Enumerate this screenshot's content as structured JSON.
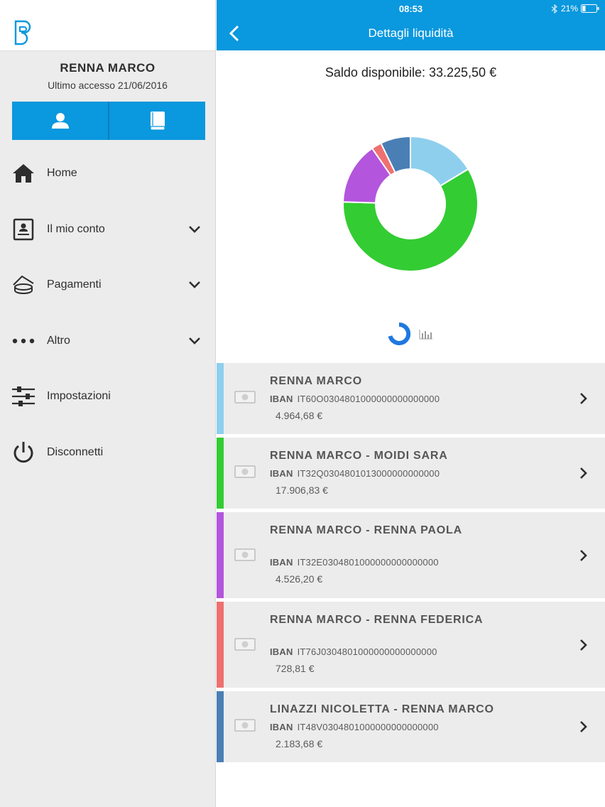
{
  "user": {
    "name": "RENNA MARCO",
    "last_access": "Ultimo accesso 21/06/2016"
  },
  "menu": [
    {
      "label": "Home",
      "icon": "home-icon",
      "expandable": false
    },
    {
      "label": "Il mio conto",
      "icon": "account-card-icon",
      "expandable": true
    },
    {
      "label": "Pagamenti",
      "icon": "payments-icon",
      "expandable": true
    },
    {
      "label": "Altro",
      "icon": "more-dots-icon",
      "expandable": true
    },
    {
      "label": "Impostazioni",
      "icon": "settings-sliders-icon",
      "expandable": false
    },
    {
      "label": "Disconnetti",
      "icon": "power-icon",
      "expandable": false
    }
  ],
  "status": {
    "time": "08:53",
    "battery": "21%"
  },
  "header": {
    "title": "Dettagli liquidità"
  },
  "saldo": "Saldo disponibile: 33.225,50 €",
  "accounts": [
    {
      "name": "RENNA MARCO",
      "iban_label": "IBAN",
      "iban": "IT60O0304801000000000000000",
      "amount": "4.964,68 €",
      "color": "#8ecfee"
    },
    {
      "name": "RENNA MARCO - MOIDI  SARA",
      "iban_label": "IBAN",
      "iban": "IT32Q0304801013000000000000",
      "amount": "17.906,83 €",
      "color": "#33cc33"
    },
    {
      "name": "RENNA MARCO - RENNA  PAOLA",
      "iban_label": "IBAN",
      "iban": "IT32E0304801000000000000000",
      "amount": "4.526,20 €",
      "color": "#b355dd"
    },
    {
      "name": "RENNA MARCO - RENNA  FEDERICA",
      "iban_label": "IBAN",
      "iban": "IT76J0304801000000000000000",
      "amount": "728,81 €",
      "color": "#ef7070"
    },
    {
      "name": "LINAZZI NICOLETTA  -  RENNA MARCO",
      "iban_label": "IBAN",
      "iban": "IT48V0304801000000000000000",
      "amount": "2.183,68 €",
      "color": "#4a7fb5"
    }
  ],
  "chart_data": {
    "type": "pie",
    "donut": true,
    "categories": [
      "RENNA MARCO",
      "RENNA MARCO - MOIDI  SARA",
      "RENNA MARCO - RENNA  PAOLA",
      "RENNA MARCO - RENNA  FEDERICA",
      "LINAZZI NICOLETTA  -  RENNA MARCO"
    ],
    "values": [
      4964.68,
      17906.83,
      4526.2,
      728.81,
      2183.68
    ],
    "colors": [
      "#8ecfee",
      "#33cc33",
      "#b355dd",
      "#ef7070",
      "#4a7fb5"
    ]
  },
  "colors": {
    "accent": "#0a98de",
    "sidebar_bg": "#ececec",
    "card_bg": "#ececec"
  }
}
